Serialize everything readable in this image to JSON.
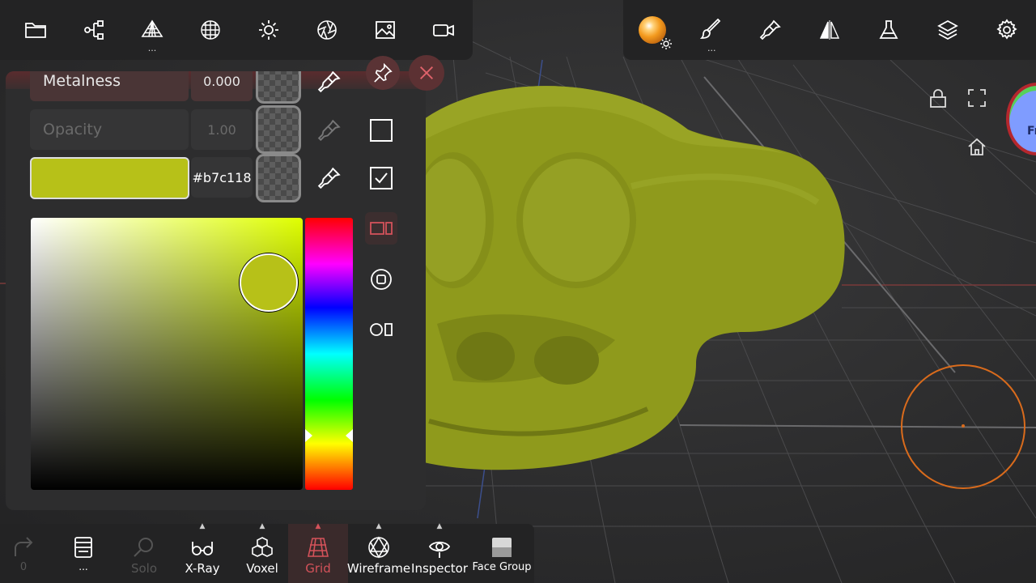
{
  "top_toolbar_left": [
    {
      "name": "files",
      "icon": "folder-icon"
    },
    {
      "name": "scene",
      "icon": "hierarchy-icon"
    },
    {
      "name": "topology",
      "icon": "topology-icon",
      "dots": "..."
    },
    {
      "name": "voxel-sphere",
      "icon": "sphere-grid-icon"
    },
    {
      "name": "lighting",
      "icon": "sun-icon"
    },
    {
      "name": "camera-aperture",
      "icon": "aperture-icon"
    },
    {
      "name": "background",
      "icon": "image-icon"
    },
    {
      "name": "camera",
      "icon": "video-camera-icon"
    }
  ],
  "top_toolbar_right": [
    {
      "name": "material",
      "icon": "material-ball-icon",
      "dots": "..."
    },
    {
      "name": "paint",
      "icon": "paintbrush-icon",
      "dots": "..."
    },
    {
      "name": "color-picker",
      "icon": "eyedropper-icon"
    },
    {
      "name": "symmetry",
      "icon": "symmetry-icon"
    },
    {
      "name": "flask",
      "icon": "flask-icon"
    },
    {
      "name": "layers",
      "icon": "layers-icon"
    },
    {
      "name": "settings",
      "icon": "gear-icon"
    }
  ],
  "color_panel": {
    "metalness": {
      "label": "Metalness",
      "value": "0.000"
    },
    "opacity": {
      "label": "Opacity",
      "value": "1.00"
    },
    "color": {
      "swatch": "#b7c118",
      "hex": "#b7c118"
    },
    "hue_level": 0.8
  },
  "bottom_toolbar": [
    {
      "name": "redo",
      "label": "0",
      "icon": "redo-icon",
      "disabled": true
    },
    {
      "name": "notes",
      "label": "...",
      "icon": "notebook-icon"
    },
    {
      "name": "solo",
      "label": "Solo",
      "icon": "magnify-icon",
      "disabled": true
    },
    {
      "name": "xray",
      "label": "X-Ray",
      "icon": "glasses-icon"
    },
    {
      "name": "voxel",
      "label": "Voxel",
      "icon": "cubes-icon"
    },
    {
      "name": "grid",
      "label": "Grid",
      "icon": "grid-icon",
      "active": true
    },
    {
      "name": "wireframe",
      "label": "Wireframe",
      "icon": "wireframe-icon"
    },
    {
      "name": "inspector",
      "label": "Inspector",
      "icon": "inspector-eye-icon"
    },
    {
      "name": "face-group",
      "label": "Face Group",
      "icon": "face-group-icon"
    }
  ],
  "gizmo": {
    "label": "Fr"
  },
  "colors": {
    "accent_red": "#d4525a",
    "brush_orange": "#d96b1c",
    "model_green": "#8f9a1c"
  }
}
